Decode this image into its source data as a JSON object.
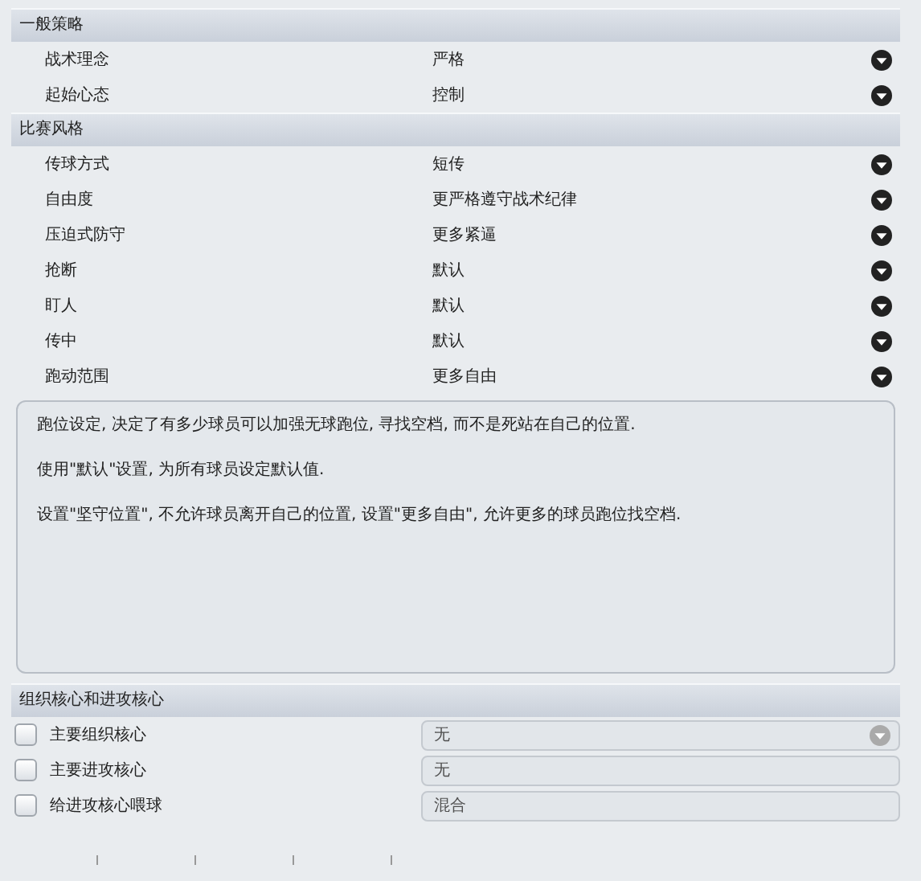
{
  "sections": [
    {
      "title": "一般策略",
      "rows": [
        {
          "label": "战术理念",
          "value": "严格"
        },
        {
          "label": "起始心态",
          "value": "控制"
        }
      ]
    },
    {
      "title": "比赛风格",
      "rows": [
        {
          "label": "传球方式",
          "value": "短传"
        },
        {
          "label": "自由度",
          "value": "更严格遵守战术纪律"
        },
        {
          "label": "压迫式防守",
          "value": "更多紧逼"
        },
        {
          "label": "抢断",
          "value": "默认"
        },
        {
          "label": "盯人",
          "value": "默认"
        },
        {
          "label": "传中",
          "value": "默认"
        },
        {
          "label": "跑动范围",
          "value": "更多自由"
        }
      ]
    }
  ],
  "description": [
    "跑位设定, 决定了有多少球员可以加强无球跑位, 寻找空档, 而不是死站在自己的位置.",
    "使用\"默认\"设置, 为所有球员设定默认值.",
    "设置\"坚守位置\", 不允许球员离开自己的位置, 设置\"更多自由\", 允许更多的球员跑位找空档."
  ],
  "playmakers": {
    "title": "组织核心和进攻核心",
    "rows": [
      {
        "label": "主要组织核心",
        "checked": false,
        "value": "无",
        "disabled": true
      },
      {
        "label": "主要进攻核心",
        "checked": false,
        "value": "无",
        "disabled": true
      },
      {
        "label": "给进攻核心喂球",
        "checked": false,
        "value": "混合",
        "disabled": true
      }
    ]
  }
}
